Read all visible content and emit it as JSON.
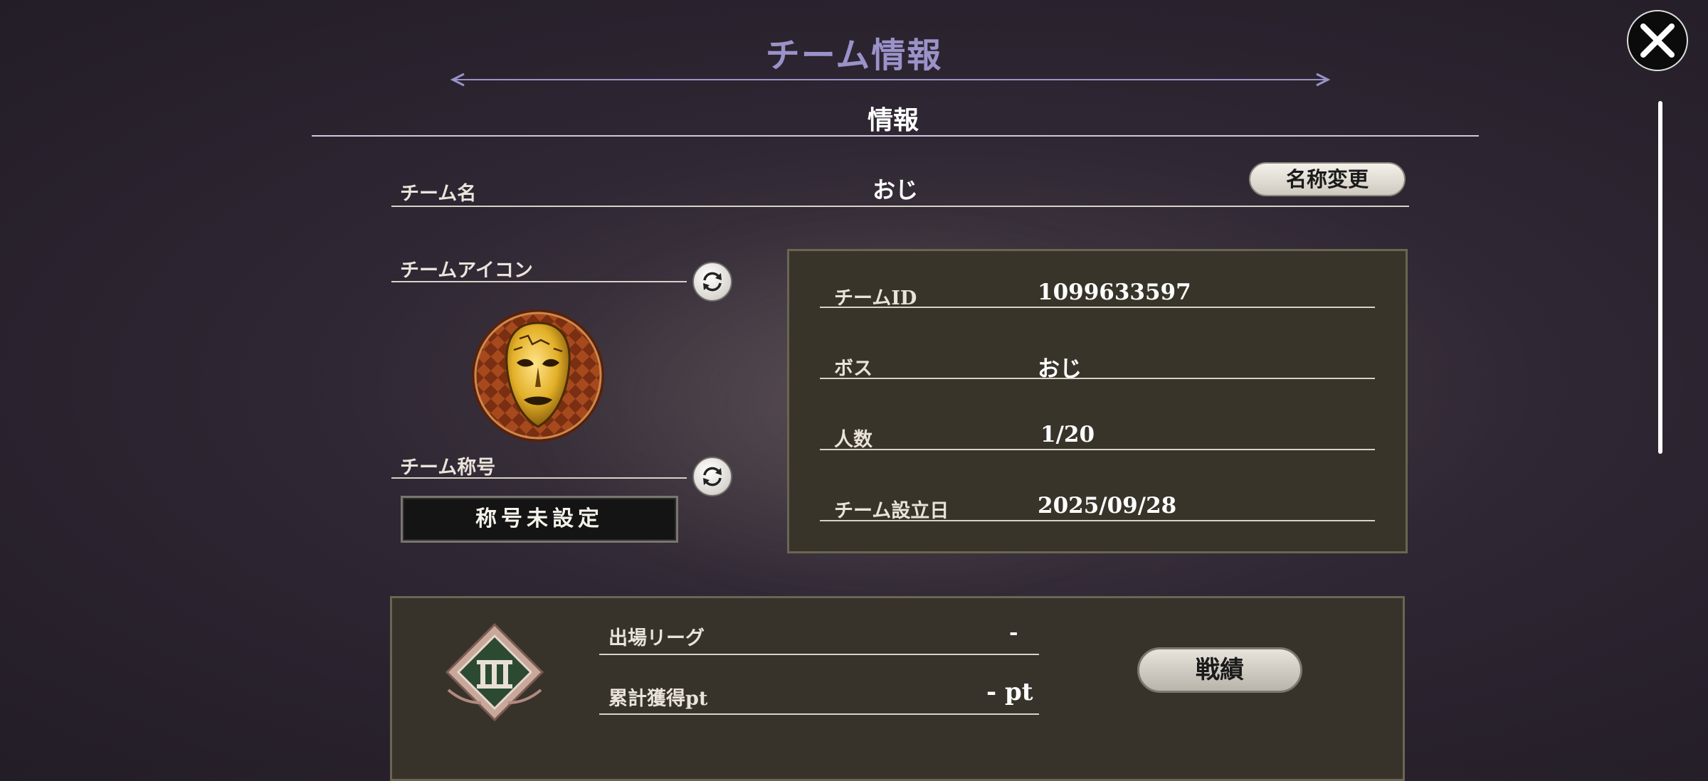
{
  "header": {
    "title": "チーム情報",
    "section": "情報"
  },
  "team_name": {
    "label": "チーム名",
    "value": "おじ",
    "rename_button": "名称変更"
  },
  "team_icon": {
    "label": "チームアイコン"
  },
  "team_title": {
    "label": "チーム称号",
    "value": "称号未設定"
  },
  "info": {
    "rows": [
      {
        "label": "チームID",
        "value": "1099633597"
      },
      {
        "label": "ボス",
        "value": "おじ"
      },
      {
        "label": "人数",
        "value": "1/20"
      },
      {
        "label": "チーム設立日",
        "value": "2025/09/28"
      }
    ]
  },
  "league": {
    "league_label": "出場リーグ",
    "league_value": "-",
    "points_label": "累計獲得pt",
    "points_value": "- pt",
    "record_button": "戦績"
  },
  "icons": {
    "close": "close-icon",
    "refresh": "refresh-icon",
    "emblem": "stone-mask-emblem",
    "league_badge": "league-rank-badge"
  },
  "colors": {
    "title": "#9a92c8",
    "panel": "#38342a",
    "panel_border": "#6b6552"
  }
}
